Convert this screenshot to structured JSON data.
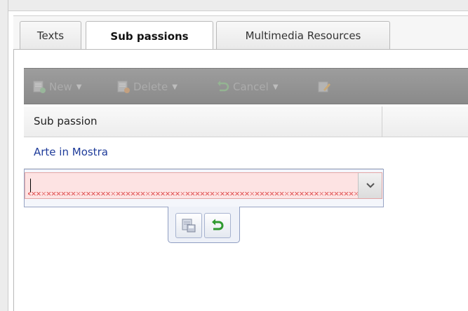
{
  "tabs": [
    {
      "label": "Texts",
      "active": false
    },
    {
      "label": "Sub passions",
      "active": true
    },
    {
      "label": "Multimedia Resources",
      "active": false
    }
  ],
  "toolbar": {
    "new_label": "New",
    "delete_label": "Delete",
    "cancel_label": "Cancel",
    "state": "disabled",
    "background_color": "#8f8f8f"
  },
  "grid": {
    "column_header": "Sub passion",
    "rows": [
      "Arte in Mostra"
    ]
  },
  "editor": {
    "input_value": "",
    "validation_state": "invalid",
    "invalid_color": "#fde3e3"
  },
  "icons": {
    "toolbar": [
      "new-record-icon",
      "delete-record-icon",
      "undo-icon",
      "edit-icon"
    ],
    "combo": "chevron-down-icon",
    "row_editor": [
      "save-icon",
      "undo-icon"
    ]
  }
}
